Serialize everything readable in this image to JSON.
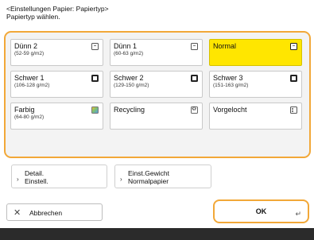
{
  "header": {
    "line1": "<Einstellungen Papier: Papiertyp>",
    "line2": "Papiertyp wählen."
  },
  "paper_types": [
    {
      "name": "Dünn 2",
      "sub": "(52-59 g/m2)",
      "icon": "plain-page-icon",
      "selected": false
    },
    {
      "name": "Dünn 1",
      "sub": "(60-63 g/m2)",
      "icon": "plain-page-icon",
      "selected": false
    },
    {
      "name": "Normal",
      "sub": "",
      "icon": "plain-page-icon",
      "selected": true
    },
    {
      "name": "Schwer 1",
      "sub": "(106-128 g/m2)",
      "icon": "thick-page-icon",
      "selected": false
    },
    {
      "name": "Schwer 2",
      "sub": "(129-150 g/m2)",
      "icon": "thick-page-icon",
      "selected": false
    },
    {
      "name": "Schwer 3",
      "sub": "(151-163 g/m2)",
      "icon": "thick-page-icon",
      "selected": false
    },
    {
      "name": "Farbig",
      "sub": "(64-80 g/m2)",
      "icon": "color-page-icon",
      "selected": false
    },
    {
      "name": "Recycling",
      "sub": "",
      "icon": "recycle-page-icon",
      "selected": false
    },
    {
      "name": "Vorgelocht",
      "sub": "",
      "icon": "punched-page-icon",
      "selected": false
    }
  ],
  "options": {
    "detail_label": "Detail.\nEinstell.",
    "weight_label": "Einst.Gewicht\nNormalpapier"
  },
  "actions": {
    "cancel_label": "Abbrechen",
    "ok_label": "OK"
  },
  "colors": {
    "accent": "#f2a838",
    "selected": "#ffe600",
    "footer": "#2b2b2b"
  }
}
